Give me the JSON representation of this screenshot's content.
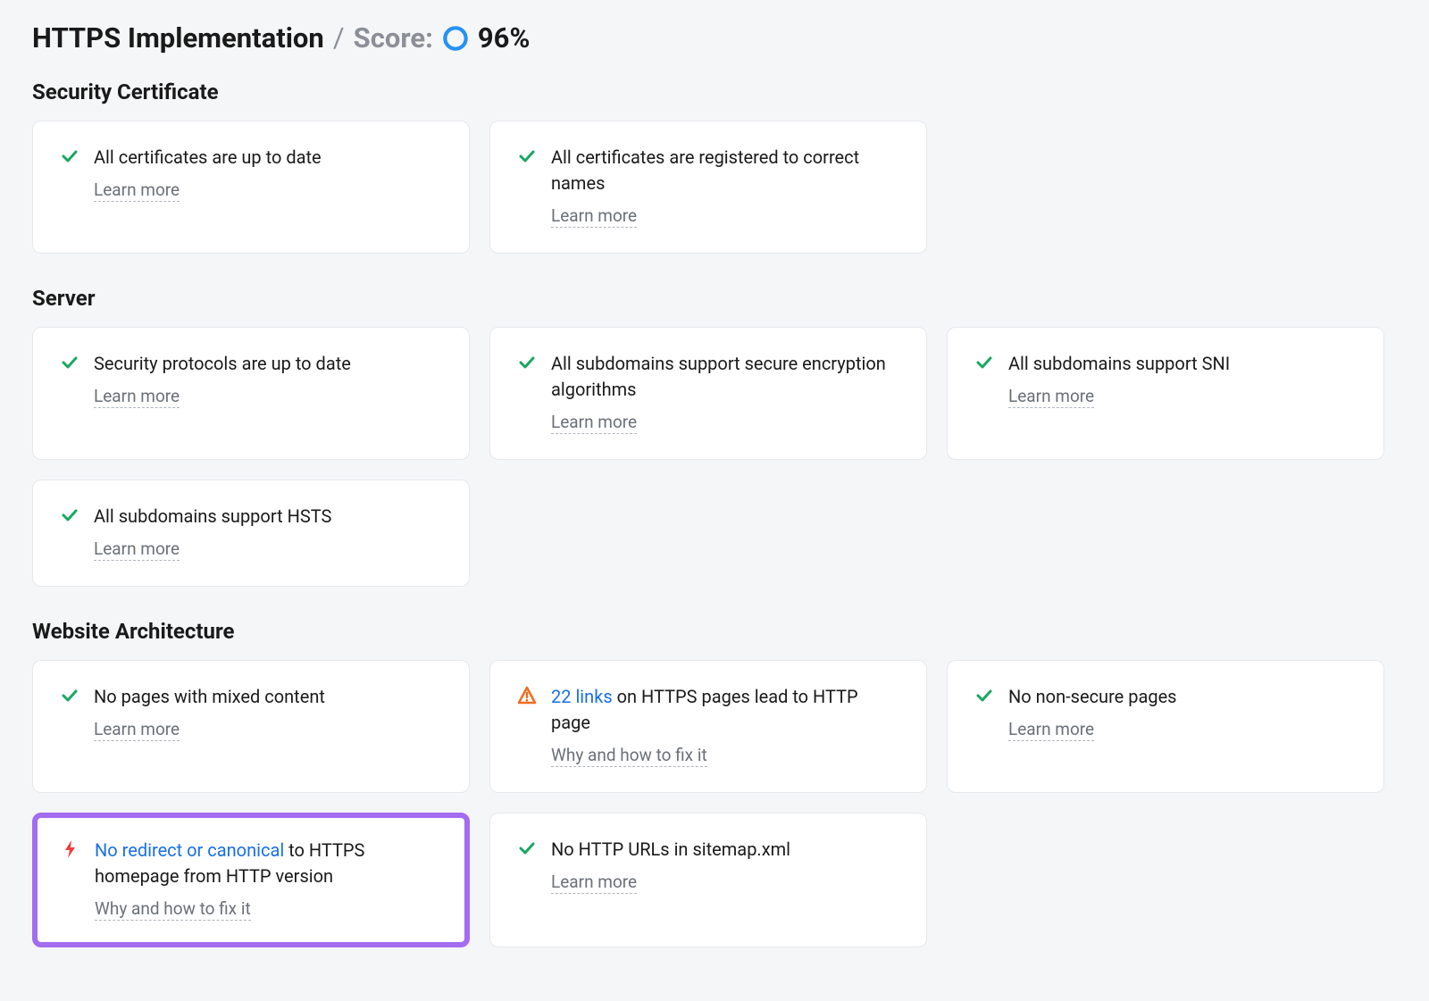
{
  "header": {
    "title": "HTTPS Implementation",
    "separator": "/",
    "score_label": "Score:",
    "score_value": "96%",
    "score_percent": 96,
    "ring_color": "#2492f4"
  },
  "learn_more": "Learn more",
  "fix_link": "Why and how to fix it",
  "sections": [
    {
      "title": "Security Certificate",
      "cards": [
        {
          "status": "ok",
          "text": "All certificates are up to date",
          "link": "learn"
        },
        {
          "status": "ok",
          "text": "All certificates are registered to correct names",
          "link": "learn"
        }
      ]
    },
    {
      "title": "Server",
      "cards": [
        {
          "status": "ok",
          "text": "Security protocols are up to date",
          "link": "learn"
        },
        {
          "status": "ok",
          "text": "All subdomains support secure encryption algorithms",
          "link": "learn"
        },
        {
          "status": "ok",
          "text": "All subdomains support SNI",
          "link": "learn"
        },
        {
          "status": "ok",
          "text": "All subdomains support HSTS",
          "link": "learn"
        }
      ]
    },
    {
      "title": "Website Architecture",
      "cards": [
        {
          "status": "ok",
          "text": "No pages with mixed content",
          "link": "learn"
        },
        {
          "status": "warn",
          "link_text": "22 links",
          "rest": " on HTTPS pages lead to HTTP page",
          "link": "fix"
        },
        {
          "status": "ok",
          "text": "No non-secure pages",
          "link": "learn"
        },
        {
          "status": "error",
          "highlight": true,
          "link_text": "No redirect or canonical",
          "rest": " to HTTPS homepage from HTTP version",
          "link": "fix"
        },
        {
          "status": "ok",
          "text": "No HTTP URLs in sitemap.xml",
          "link": "learn"
        }
      ]
    }
  ]
}
